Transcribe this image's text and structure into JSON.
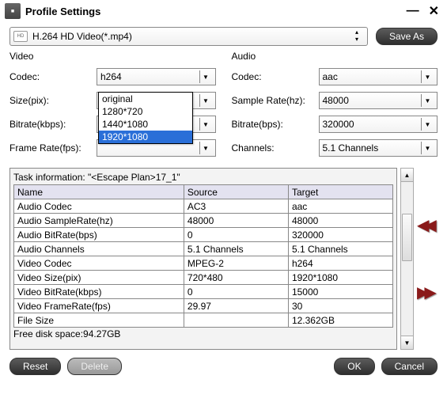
{
  "window": {
    "title": "Profile Settings"
  },
  "profile": {
    "codec_badge": "HD",
    "label": "H.264 HD Video(*.mp4)"
  },
  "buttons": {
    "save_as": "Save As",
    "reset": "Reset",
    "delete": "Delete",
    "ok": "OK",
    "cancel": "Cancel"
  },
  "video": {
    "title": "Video",
    "codec_label": "Codec:",
    "codec_value": "h264",
    "size_label": "Size(pix):",
    "size_value": "1920*1080",
    "bitrate_label": "Bitrate(kbps):",
    "bitrate_value": "",
    "framerate_label": "Frame Rate(fps):",
    "framerate_value": "",
    "dropdown": {
      "opt0": "original",
      "opt1": "1280*720",
      "opt2": "1440*1080",
      "opt3": "1920*1080"
    }
  },
  "audio": {
    "title": "Audio",
    "codec_label": "Codec:",
    "codec_value": "aac",
    "sr_label": "Sample Rate(hz):",
    "sr_value": "48000",
    "bitrate_label": "Bitrate(bps):",
    "bitrate_value": "320000",
    "channels_label": "Channels:",
    "channels_value": "5.1 Channels"
  },
  "task": {
    "info": "Task information: \"<Escape Plan>17_1\"",
    "headers": {
      "name": "Name",
      "source": "Source",
      "target": "Target"
    },
    "rows": {
      "r0": {
        "n": "Audio Codec",
        "s": "AC3",
        "t": "aac"
      },
      "r1": {
        "n": "Audio SampleRate(hz)",
        "s": "48000",
        "t": "48000"
      },
      "r2": {
        "n": "Audio BitRate(bps)",
        "s": "0",
        "t": "320000"
      },
      "r3": {
        "n": "Audio Channels",
        "s": "5.1 Channels",
        "t": "5.1 Channels"
      },
      "r4": {
        "n": "Video Codec",
        "s": "MPEG-2",
        "t": "h264"
      },
      "r5": {
        "n": "Video Size(pix)",
        "s": "720*480",
        "t": "1920*1080"
      },
      "r6": {
        "n": "Video BitRate(kbps)",
        "s": "0",
        "t": "15000"
      },
      "r7": {
        "n": "Video FrameRate(fps)",
        "s": "29.97",
        "t": "30"
      },
      "r8": {
        "n": "File Size",
        "s": "",
        "t": "12.362GB"
      }
    },
    "free_disk": "Free disk space:94.27GB"
  }
}
